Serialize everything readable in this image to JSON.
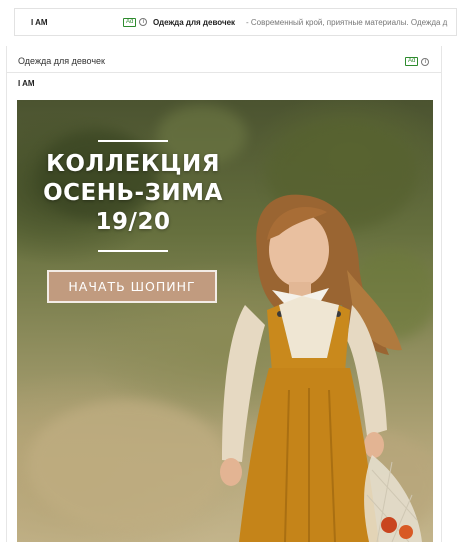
{
  "inbox_row": {
    "sender": "I AM",
    "ad_badge": "Ad",
    "info_icon": "ⓘ",
    "subject": "Одежда для девочек",
    "snippet": "- Современный крой, приятные материалы. Одежда д"
  },
  "email": {
    "subject": "Одежда для девочек",
    "ad_badge": "Ad",
    "sender": "I AM"
  },
  "banner": {
    "headline_lines": [
      "КОЛЛЕКЦИЯ",
      "ОСЕНЬ-ЗИМА",
      "19/20"
    ],
    "cta_label": "НАЧАТЬ ШОПИНГ"
  },
  "colors": {
    "ad_green": "#2e8b2e",
    "cta_background": "#c19b7f",
    "dress_mustard": "#c9891c"
  },
  "icons": {
    "info": "info-icon"
  }
}
